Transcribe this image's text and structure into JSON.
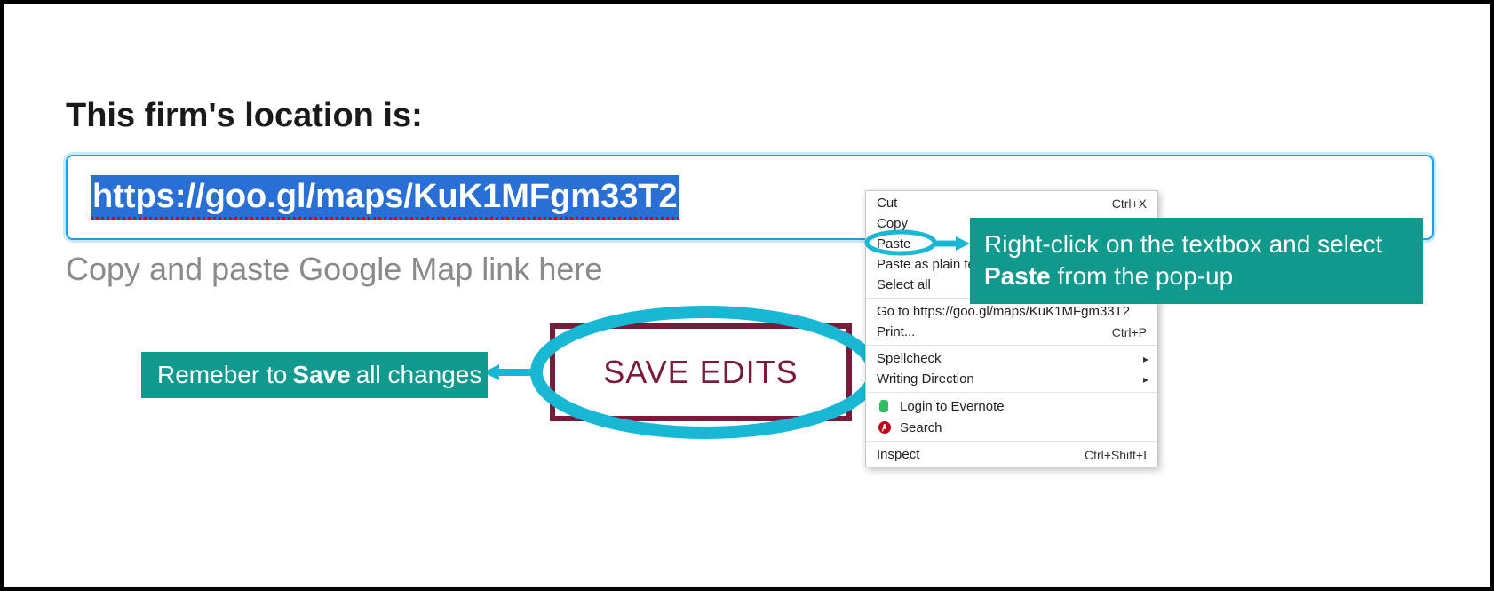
{
  "heading": "This firm's location is:",
  "input": {
    "value": "https://goo.gl/maps/KuK1MFgm33T2",
    "helper": "Copy and paste Google Map link here"
  },
  "save_button": "SAVE EDITS",
  "context_menu": {
    "cut": {
      "label": "Cut",
      "shortcut": "Ctrl+X"
    },
    "copy": {
      "label": "Copy"
    },
    "paste": {
      "label": "Paste"
    },
    "paste_plain": {
      "label": "Paste as plain text"
    },
    "select_all": {
      "label": "Select all"
    },
    "goto": {
      "label": "Go to https://goo.gl/maps/KuK1MFgm33T2"
    },
    "print": {
      "label": "Print...",
      "shortcut": "Ctrl+P"
    },
    "spellcheck": {
      "label": "Spellcheck"
    },
    "writing_dir": {
      "label": "Writing Direction"
    },
    "evernote": {
      "label": "Login to Evernote"
    },
    "search": {
      "label": "Search"
    },
    "inspect": {
      "label": "Inspect",
      "shortcut": "Ctrl+Shift+I"
    }
  },
  "callouts": {
    "paste_prefix": "Right-click on the textbox and select ",
    "paste_bold": "Paste",
    "paste_suffix": " from the pop-up",
    "save_prefix": "Remeber to ",
    "save_bold": "Save",
    "save_suffix": " all changes"
  }
}
